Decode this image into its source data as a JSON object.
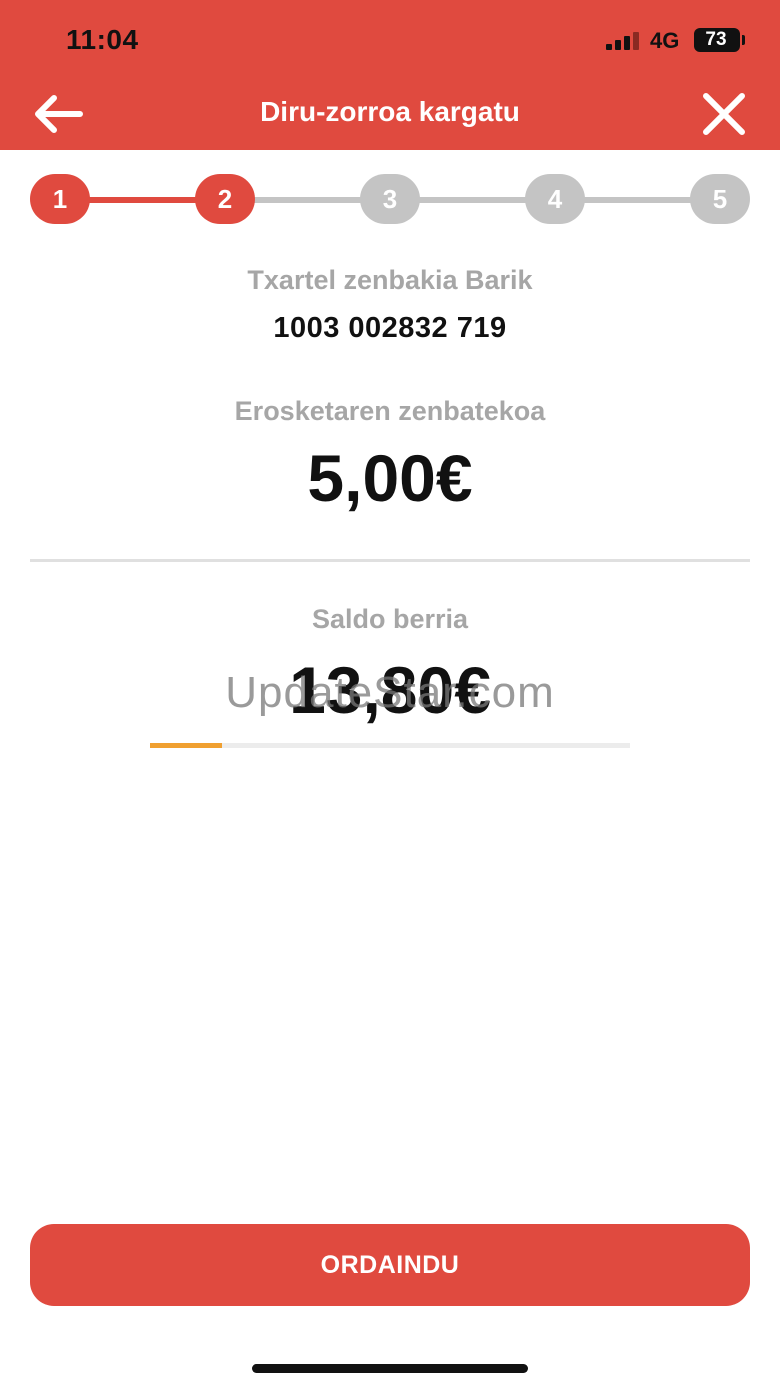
{
  "status_bar": {
    "time": "11:04",
    "network": "4G",
    "battery_percent": "73"
  },
  "header": {
    "title": "Diru-zorroa kargatu",
    "back_icon": "arrow-left-icon",
    "close_icon": "close-icon",
    "background_color": "#e04a3f"
  },
  "stepper": {
    "steps": [
      "1",
      "2",
      "3",
      "4",
      "5"
    ],
    "current_step": 2,
    "active_color": "#e04a3f",
    "inactive_color": "#c4c4c4"
  },
  "card": {
    "label": "Txartel zenbakia Barik",
    "number": "1003 002832 719"
  },
  "purchase": {
    "label": "Erosketaren zenbatekoa",
    "amount": "5,00€"
  },
  "balance": {
    "label": "Saldo berria",
    "amount": "13,80€"
  },
  "watermark": "UpdateStar.com",
  "progress": {
    "fraction": 0.15,
    "color": "#f0a030"
  },
  "actions": {
    "pay_label": "ORDAINDU"
  }
}
